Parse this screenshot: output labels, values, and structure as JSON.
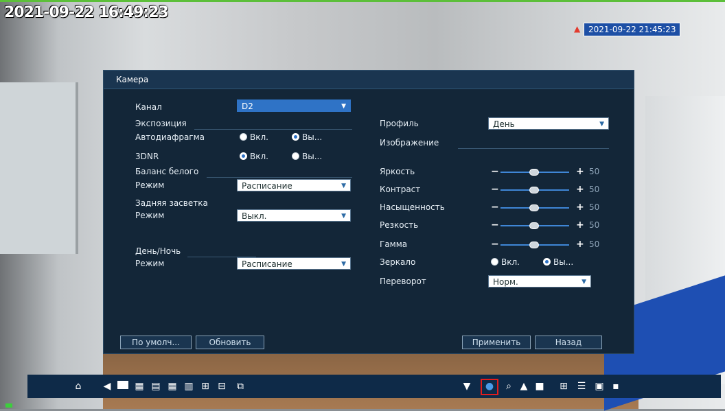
{
  "osd": {
    "time_left": "2021-09-22 16:49:23",
    "time_right": "2021-09-22 21:45:23"
  },
  "dialog": {
    "title": "Камера",
    "left": {
      "channel_label": "Канал",
      "channel_value": "D2",
      "exposure_section": "Экспозиция",
      "auto_iris_label": "Автодиафрагма",
      "auto_iris_on": "Вкл.",
      "auto_iris_off": "Вы...",
      "dnr_label": "3DNR",
      "dnr_on": "Вкл.",
      "dnr_off": "Вы...",
      "white_balance_section": "Баланс белого",
      "wb_mode_label": "Режим",
      "wb_mode_value": "Расписание",
      "backlight_section": "Задняя засветка",
      "backlight_mode_label": "Режим",
      "backlight_mode_value": "Выкл.",
      "daynight_section": "День/Ночь",
      "daynight_mode_label": "Режим",
      "daynight_mode_value": "Расписание"
    },
    "right": {
      "profile_label": "Профиль",
      "profile_value": "День",
      "image_section": "Изображение",
      "sliders": [
        {
          "label": "Яркость",
          "value": "50"
        },
        {
          "label": "Контраст",
          "value": "50"
        },
        {
          "label": "Насыщенность",
          "value": "50"
        },
        {
          "label": "Резкость",
          "value": "50"
        },
        {
          "label": "Гамма",
          "value": "50"
        }
      ],
      "mirror_label": "Зеркало",
      "mirror_on": "Вкл.",
      "mirror_off": "Вы...",
      "flip_label": "Переворот",
      "flip_value": "Норм."
    },
    "buttons": {
      "default": "По умолч...",
      "refresh": "Обновить",
      "apply": "Применить",
      "back": "Назад"
    }
  },
  "state": {
    "auto_iris": "off",
    "dnr": "on",
    "mirror": "off"
  },
  "colors": {
    "accent": "#2f73c6",
    "dialog_bg": "#132638",
    "taskbar_bg": "#0e2a48",
    "selected_border": "#e21d1d"
  }
}
